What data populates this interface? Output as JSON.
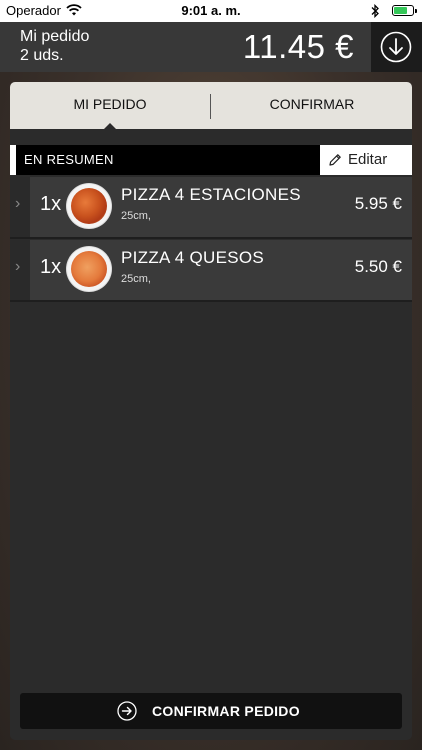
{
  "status_bar": {
    "carrier": "Operador",
    "time": "9:01 a. m.",
    "battery_level": 0.7
  },
  "header": {
    "title": "Mi pedido",
    "count": "2 uds.",
    "total": "11.45 €",
    "download_icon": "arrow-down-circle-icon"
  },
  "tabs": [
    {
      "label": "MI PEDIDO",
      "active": true
    },
    {
      "label": "CONFIRMAR",
      "active": false
    }
  ],
  "summary": {
    "label": "EN RESUMEN",
    "edit_label": "Editar",
    "edit_icon": "pencil-icon"
  },
  "items": [
    {
      "qty": "1x",
      "name": "PIZZA 4 ESTACIONES",
      "size": "25cm,",
      "price": "5.95 €"
    },
    {
      "qty": "1x",
      "name": "PIZZA 4 QUESOS",
      "size": "25cm,",
      "price": "5.50 €"
    }
  ],
  "confirm": {
    "label": "CONFIRMAR PEDIDO",
    "icon": "arrow-right-circle-icon"
  },
  "colors": {
    "header_bg": "#383838",
    "tab_bg": "#e5e3dd",
    "card_bg": "#2b2b2b",
    "button_bg": "#111111",
    "battery": "#35c759"
  }
}
